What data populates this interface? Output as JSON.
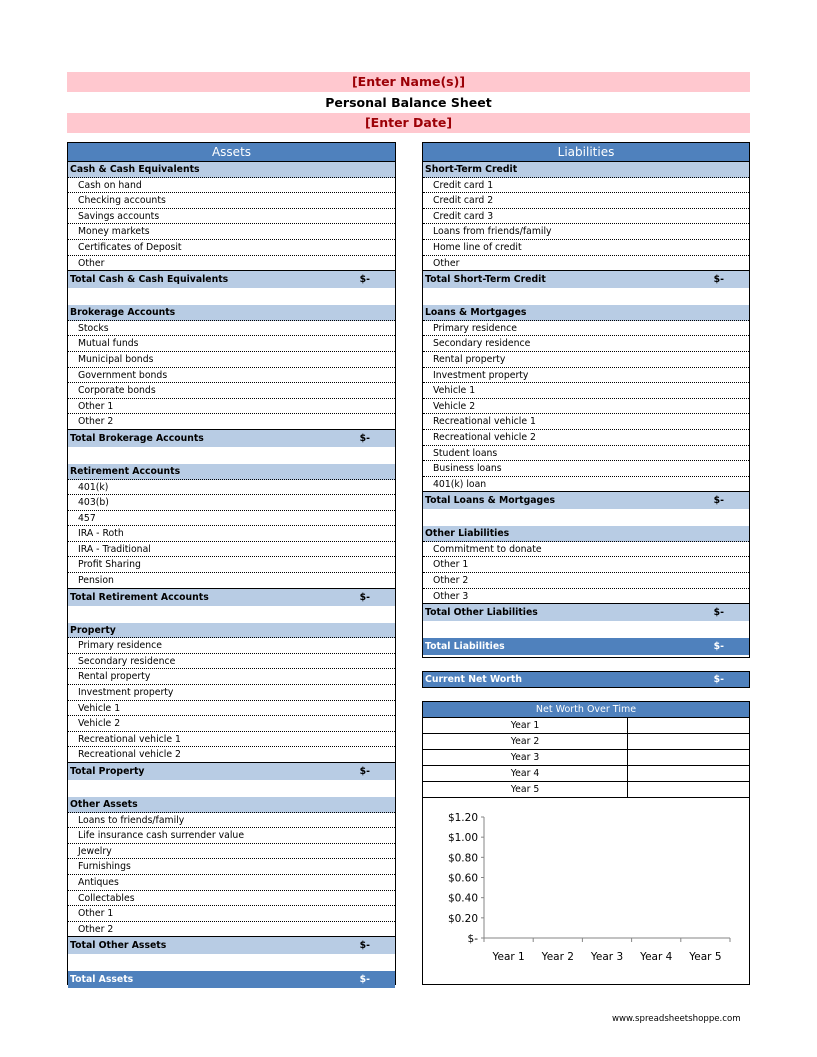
{
  "header": {
    "name_placeholder": "[Enter Name(s)]",
    "title": "Personal Balance Sheet",
    "date_placeholder": "[Enter Date]"
  },
  "colors": {
    "header_blue": "#4f81bd",
    "section_blue": "#b8cce4",
    "pink_band": "#ffc8cf",
    "pink_text": "#9c0006"
  },
  "assets": {
    "title": "Assets",
    "sections": [
      {
        "name": "Cash & Cash Equivalents",
        "items": [
          "Cash on hand",
          "Checking accounts",
          "Savings accounts",
          "Money markets",
          "Certificates of Deposit",
          "Other"
        ],
        "total_label": "Total Cash & Cash Equivalents",
        "total_value": "$-"
      },
      {
        "name": "Brokerage Accounts",
        "items": [
          "Stocks",
          "Mutual funds",
          "Municipal bonds",
          "Government bonds",
          "Corporate bonds",
          "Other 1",
          "Other 2"
        ],
        "total_label": "Total Brokerage Accounts",
        "total_value": "$-"
      },
      {
        "name": "Retirement Accounts",
        "items": [
          "401(k)",
          "403(b)",
          "457",
          "IRA - Roth",
          "IRA - Traditional",
          "Profit Sharing",
          "Pension"
        ],
        "total_label": "Total Retirement Accounts",
        "total_value": "$-"
      },
      {
        "name": "Property",
        "items": [
          "Primary  residence",
          "Secondary residence",
          "Rental property",
          "Investment property",
          "Vehicle 1",
          "Vehicle 2",
          "Recreational vehicle 1",
          "Recreational vehicle 2"
        ],
        "total_label": "Total Property",
        "total_value": "$-"
      },
      {
        "name": "Other Assets",
        "items": [
          "Loans to friends/family",
          "Life insurance cash surrender value",
          "Jewelry",
          "Furnishings",
          "Antiques",
          "Collectables",
          "Other 1",
          "Other 2"
        ],
        "total_label": "Total Other Assets",
        "total_value": "$-"
      }
    ],
    "grand_total_label": "Total Assets",
    "grand_total_value": "$-"
  },
  "liabilities": {
    "title": "Liabilities",
    "sections": [
      {
        "name": "Short-Term Credit",
        "items": [
          "Credit card 1",
          "Credit card 2",
          "Credit card 3",
          "Loans from friends/family",
          "Home line of credit",
          "Other"
        ],
        "total_label": "Total Short-Term Credit",
        "total_value": "$-"
      },
      {
        "name": "Loans & Mortgages",
        "items": [
          "Primary  residence",
          "Secondary residence",
          "Rental property",
          "Investment property",
          "Vehicle 1",
          "Vehicle 2",
          "Recreational vehicle 1",
          "Recreational vehicle 2",
          "Student loans",
          "Business loans",
          "401(k) loan"
        ],
        "total_label": "Total Loans & Mortgages",
        "total_value": "$-"
      },
      {
        "name": "Other Liabilities",
        "items": [
          "Commitment to donate",
          "Other 1",
          "Other 2",
          "Other 3"
        ],
        "total_label": "Total Other Liabilities",
        "total_value": "$-"
      }
    ],
    "grand_total_label": "Total Liabilities",
    "grand_total_value": "$-"
  },
  "net_worth": {
    "label": "Current Net Worth",
    "value": "$-"
  },
  "net_worth_over_time": {
    "title": "Net Worth Over Time",
    "rows": [
      {
        "label": "Year 1",
        "value": ""
      },
      {
        "label": "Year 2",
        "value": ""
      },
      {
        "label": "Year 3",
        "value": ""
      },
      {
        "label": "Year 4",
        "value": ""
      },
      {
        "label": "Year 5",
        "value": ""
      }
    ]
  },
  "chart_data": {
    "type": "line",
    "title": "",
    "xlabel": "",
    "ylabel": "",
    "categories": [
      "Year 1",
      "Year 2",
      "Year 3",
      "Year 4",
      "Year 5"
    ],
    "series": [
      {
        "name": "Net Worth",
        "values": [
          null,
          null,
          null,
          null,
          null
        ]
      }
    ],
    "ylim": [
      0,
      1.2
    ],
    "y_ticks": [
      0,
      0.2,
      0.4,
      0.6,
      0.8,
      1.0,
      1.2
    ],
    "y_tick_labels": [
      "$-",
      "$0.20",
      "$0.40",
      "$0.60",
      "$0.80",
      "$1.00",
      "$1.20"
    ],
    "grid": false,
    "legend": "none"
  },
  "footer": {
    "url_text": "www.spreadsheetshoppe.com"
  }
}
